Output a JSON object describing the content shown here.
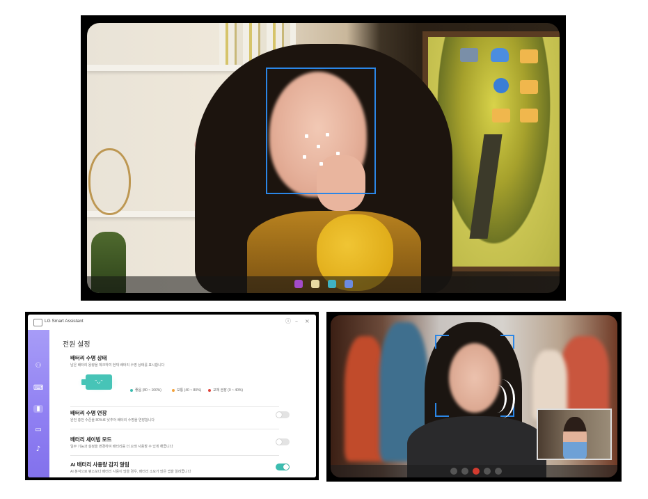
{
  "top_photo": {
    "desktop_icons": [
      "monitor-icon",
      "cloud-icon",
      "folder-icon",
      "globe-icon",
      "folder-icon",
      "folder-icon",
      "folder-icon"
    ],
    "taskbar_icons": [
      "app-purple",
      "app-yellow",
      "app-teal",
      "app-blue"
    ],
    "face_box_color": "#2b86e6"
  },
  "lg_app": {
    "title": "LG Smart Assistant",
    "page_heading": "전원 설정",
    "sidebar_icons": [
      "personalize-icon",
      "keyboard-icon",
      "battery-icon",
      "display-icon",
      "audio-icon"
    ],
    "battery_status": {
      "title": "배터리 수명 상태",
      "description": "남은 배터리 용량을 체크하여 현재 배터리 수명 상태를 표시합니다",
      "battery_face": "ᵔᴗᵔ",
      "legend": [
        {
          "label": "좋음 (80 ~ 100%)",
          "color": "#3cbdb0"
        },
        {
          "label": "보통 (40 ~ 80%)",
          "color": "#f3a23a"
        },
        {
          "label": "교체 권장 (0 ~ 40%)",
          "color": "#e0433a"
        }
      ]
    },
    "battery_life_extend": {
      "title": "배터리 수명 연장",
      "description": "완전 충전 수준을 80%로 낮추어 배터리 수명을 연장합니다",
      "enabled": false
    },
    "battery_saving_mode": {
      "title": "배터리 세이빙 모드",
      "description": "일부 기능과 설정을 변경하여 배터리를 더 오래 사용할 수 있게 해줍니다",
      "enabled": false
    },
    "ai_battery_alert": {
      "title": "AI 배터리 사용량 감지 알림",
      "description": "AI 분석으로 평소보다 배터리 사용이 많을 경우, 배터리 소모가 많은 앱을 알려줍니다",
      "enabled": true
    },
    "colors": {
      "sidebar": "#8f7ff2",
      "accent": "#3cbdb0"
    }
  },
  "video_call": {
    "controls": [
      "mic-icon",
      "camera-icon",
      "end-call-icon",
      "more-icon",
      "settings-icon"
    ],
    "face_box_color": "#2b86e6"
  }
}
